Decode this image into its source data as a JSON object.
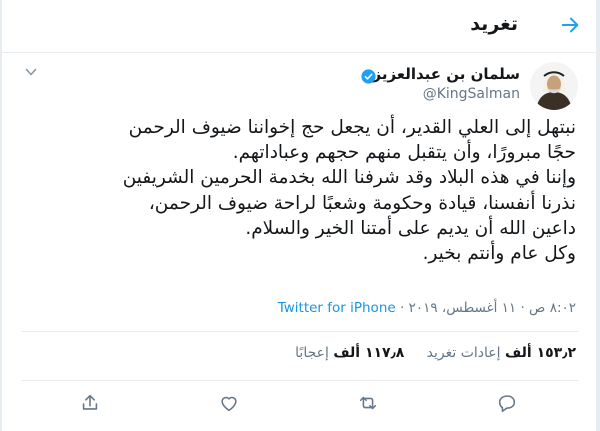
{
  "header": {
    "title": "تغريد"
  },
  "tweet": {
    "author_name": "سلمان بن عبدالعزيز",
    "handle": "@KingSalman",
    "text": "نبتهل إلى العلي القدير، أن يجعل حج إخواننا ضيوف الرحمن\nحجًا مبرورًا، وأن يتقبل منهم حجهم وعباداتهم.\nوإننا في هذه البلاد وقد شرفنا الله بخدمة الحرمين الشريفين\nنذرنا أنفسنا، قيادة وحكومة وشعبًا لراحة ضيوف الرحمن،\nداعين الله أن يديم على أمتنا الخير والسلام.\nوكل عام وأنتم بخير.",
    "time": "٨:٠٢ ص · ١١ أغسطس، ٢٠١٩ · ",
    "source": "Twitter for iPhone"
  },
  "stats": {
    "retweets_count": "١٥٣٫٢ ألف",
    "retweets_label": "إعادات تغريد",
    "likes_count": "١١٧٫٨ ألف",
    "likes_label": "إعجابًا"
  },
  "colors": {
    "accent": "#1da1f2",
    "text": "#14171a",
    "muted": "#657786",
    "border": "#e6ecf0"
  }
}
